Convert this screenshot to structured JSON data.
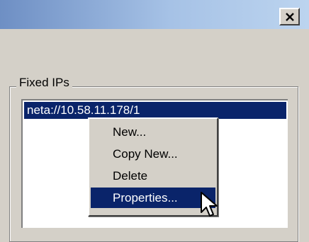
{
  "window": {
    "close_glyph": "✕"
  },
  "group": {
    "label": "Fixed IPs"
  },
  "list": {
    "items": [
      {
        "label": "neta://10.58.11.178/1",
        "selected": true
      }
    ]
  },
  "context_menu": {
    "items": [
      {
        "label": "New...",
        "selected": false
      },
      {
        "label": "Copy New...",
        "selected": false
      },
      {
        "label": "Delete",
        "selected": false
      },
      {
        "label": "Properties...",
        "selected": true
      }
    ]
  },
  "colors": {
    "selection": "#0a246a",
    "face": "#d4d0c8",
    "title_gradient_start": "#6e8fc4",
    "title_gradient_end": "#bcd4ef"
  },
  "icons": {
    "close": "close-icon",
    "cursor": "mouse-pointer-icon"
  }
}
